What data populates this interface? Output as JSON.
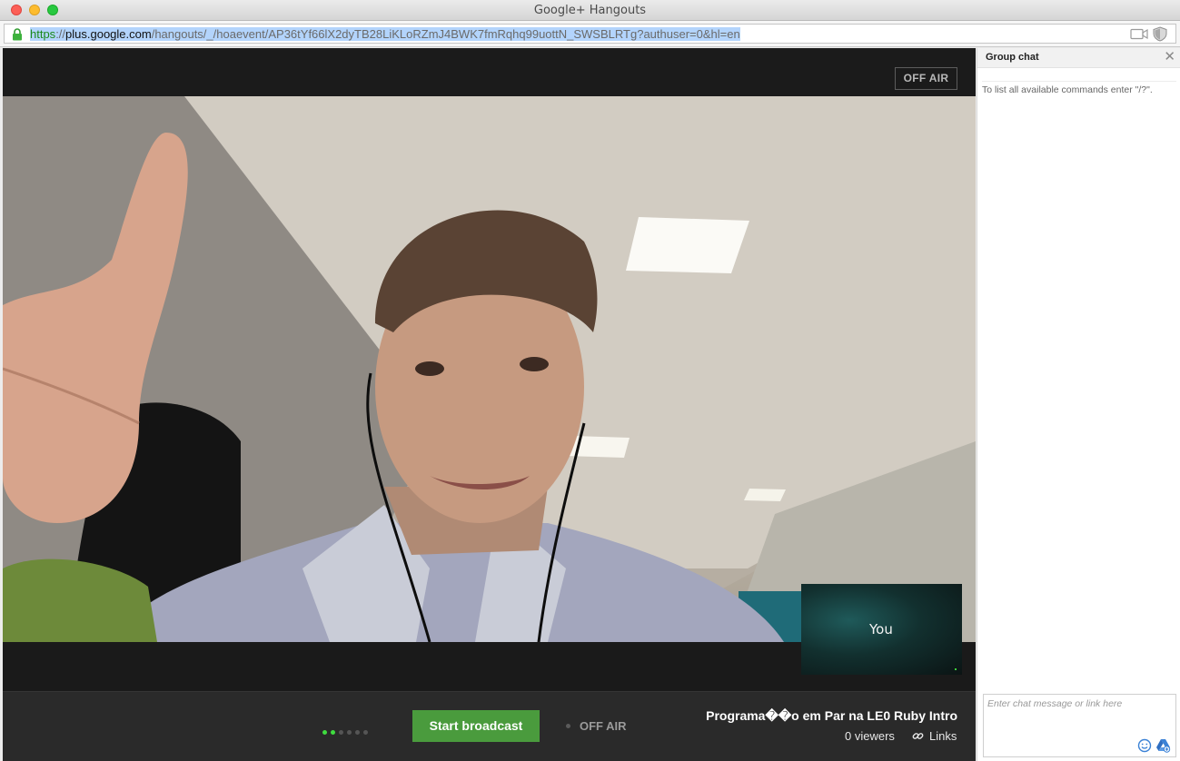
{
  "window": {
    "title": "Google+ Hangouts",
    "url_scheme": "https",
    "url_sep": "://",
    "url_host": "plus.google.com",
    "url_path": "/hangouts/_/hoaevent/AP36tYf66lX2dyTB28LiKLoRZmJ4BWK7fmRqhq99uottN_SWSBLRTg?authuser=0&hl=en"
  },
  "stage": {
    "status_badge": "OFF AIR",
    "self_view_label": "You"
  },
  "bottombar": {
    "progress_dots_total": 6,
    "progress_dots_active": 2,
    "start_button": "Start broadcast",
    "status_text": "OFF AIR",
    "event_title": "Programa��o em Par na LE0 Ruby Intro",
    "viewers": "0 viewers",
    "links_label": "Links"
  },
  "chat": {
    "title": "Group chat",
    "hint": "To list all available commands enter \"/?\".",
    "input_placeholder": "Enter chat message or link here"
  },
  "colors": {
    "start_button": "#4a9b3d",
    "active_dot": "#3fdc3f",
    "url_selection": "#b3d4fc"
  }
}
